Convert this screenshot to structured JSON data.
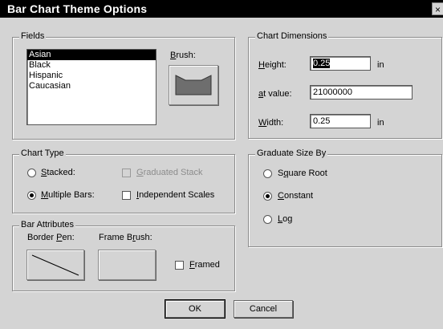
{
  "window": {
    "title": "Bar Chart Theme Options",
    "close_glyph": "×"
  },
  "fields": {
    "legend": "Fields",
    "items": [
      "Asian",
      "Black",
      "Hispanic",
      "Caucasian"
    ],
    "selected_index": 0,
    "brush_label": "Brush:",
    "brush_color": "#6e6e6e"
  },
  "dimensions": {
    "legend": "Chart Dimensions",
    "height_label": "Height:",
    "height_value": "0.25",
    "height_unit": "in",
    "at_value_label": "at value:",
    "at_value_value": "21000000",
    "width_label": "Width:",
    "width_value": "0.25",
    "width_unit": "in"
  },
  "chart_type": {
    "legend": "Chart Type",
    "stacked_label": "Stacked:",
    "stacked_checked": false,
    "multiple_label": "Multiple Bars:",
    "multiple_checked": true,
    "graduated_stack_label": "Graduated Stack",
    "graduated_stack_enabled": false,
    "independent_label": "Independent Scales",
    "independent_checked": false
  },
  "graduate": {
    "legend": "Graduate Size By",
    "square_root_label": "Square Root",
    "constant_label": "Constant",
    "log_label": "Log",
    "selected": "Constant"
  },
  "bar_attributes": {
    "legend": "Bar Attributes",
    "border_pen_label": "Border Pen:",
    "frame_brush_label": "Frame Brush:",
    "framed_label": "Framed",
    "framed_checked": false
  },
  "buttons": {
    "ok": "OK",
    "cancel": "Cancel"
  }
}
